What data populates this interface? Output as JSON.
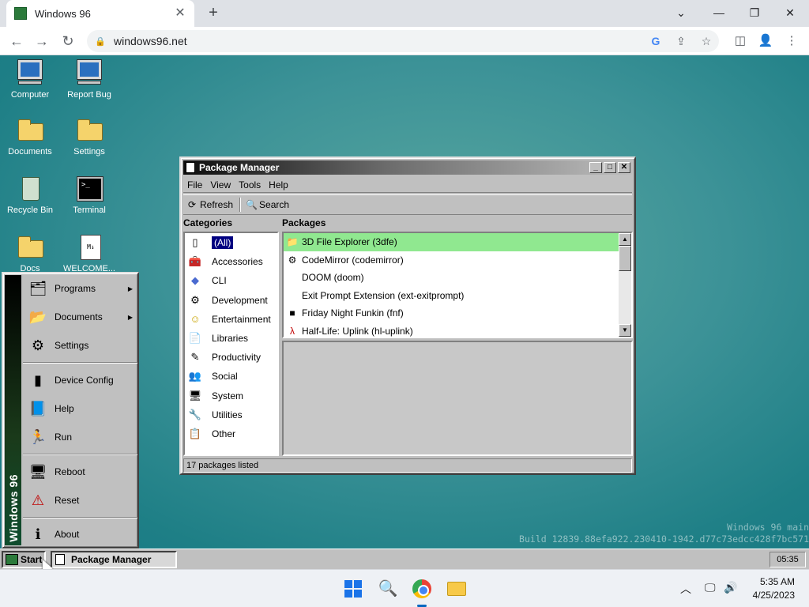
{
  "browser": {
    "tab_title": "Windows 96",
    "tab_close": "✕",
    "new_tab": "+",
    "url": "windows96.net",
    "window_controls": {
      "dropdown": "⌄",
      "minimize": "—",
      "restore": "❐",
      "close": "✕"
    },
    "nav": {
      "back": "←",
      "forward": "→",
      "reload": "↻"
    },
    "icons": {
      "google": "G",
      "share": "⇪",
      "star": "☆",
      "sidepanel": "◫",
      "profile": "👤",
      "menu": "⋮"
    }
  },
  "desktop": {
    "icons": [
      {
        "label": "Computer"
      },
      {
        "label": "Report Bug"
      },
      {
        "label": "Documents"
      },
      {
        "label": "Settings"
      },
      {
        "label": "Recycle Bin"
      },
      {
        "label": "Terminal"
      },
      {
        "label": "Docs"
      },
      {
        "label": "WELCOME..."
      }
    ],
    "terminal_glyph": ">_",
    "welcome_glyph": "M↓",
    "build_line1": "Windows 96 main",
    "build_line2": "Build 12839.88efa922.230410-1942.d77c73edcc428f7bc571"
  },
  "package_manager": {
    "title": "Package Manager",
    "title_buttons": {
      "min": "_",
      "max": "□",
      "close": "✕"
    },
    "menu": [
      "File",
      "View",
      "Tools",
      "Help"
    ],
    "toolbar": {
      "refresh": "Refresh",
      "search": "Search"
    },
    "categories_header": "Categories",
    "packages_header": "Packages",
    "categories": [
      {
        "label": "(All)",
        "icon": "▯"
      },
      {
        "label": "Accessories",
        "icon": "🧰"
      },
      {
        "label": "CLI",
        "icon": "◆"
      },
      {
        "label": "Development",
        "icon": "⚙"
      },
      {
        "label": "Entertainment",
        "icon": "☺"
      },
      {
        "label": "Libraries",
        "icon": "📄"
      },
      {
        "label": "Productivity",
        "icon": "✎"
      },
      {
        "label": "Social",
        "icon": "👥"
      },
      {
        "label": "System",
        "icon": "🖥"
      },
      {
        "label": "Utilities",
        "icon": "🔧"
      },
      {
        "label": "Other",
        "icon": "📋"
      }
    ],
    "packages": [
      {
        "label": "3D File Explorer (3dfe)",
        "icon": "📁"
      },
      {
        "label": "CodeMirror (codemirror)",
        "icon": "⚙"
      },
      {
        "label": "DOOM (doom)",
        "icon": ""
      },
      {
        "label": "Exit Prompt Extension (ext-exitprompt)",
        "icon": ""
      },
      {
        "label": "Friday Night Funkin (fnf)",
        "icon": "■"
      },
      {
        "label": "Half-Life: Uplink (hl-uplink)",
        "icon": "λ"
      }
    ],
    "status": "17 packages listed"
  },
  "start_menu": {
    "band_text": "Windows 96",
    "items": [
      {
        "label": "Programs",
        "icon": "🗂",
        "submenu": "▶"
      },
      {
        "label": "Documents",
        "icon": "📂",
        "submenu": "▶"
      },
      {
        "label": "Settings",
        "icon": "⚙"
      },
      {
        "label": "Device Config",
        "icon": "▮"
      },
      {
        "label": "Help",
        "icon": "📘"
      },
      {
        "label": "Run",
        "icon": "🏃"
      },
      {
        "label": "Reboot",
        "icon": "🖥"
      },
      {
        "label": "Reset",
        "icon": "⚠"
      },
      {
        "label": "About",
        "icon": "ℹ"
      }
    ]
  },
  "w96_taskbar": {
    "start_label": "Start",
    "task_label": "Package Manager",
    "clock": "05:35"
  },
  "os_taskbar": {
    "search_icon": "🔍",
    "tray_chevron": "︿",
    "tray_display": "🖵",
    "tray_volume": "🔊",
    "time": "5:35 AM",
    "date": "4/25/2023"
  }
}
